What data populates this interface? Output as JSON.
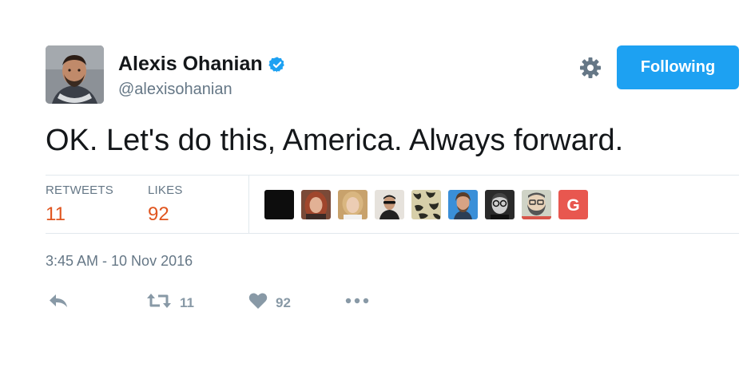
{
  "tweet": {
    "author_name": "Alexis Ohanian",
    "handle": "@alexisohanian",
    "text": "OK. Let's do this, America. Always forward.",
    "timestamp": "3:45 AM - 10 Nov 2016"
  },
  "follow_button": {
    "label": "Following",
    "color": "#1da1f2"
  },
  "stats": {
    "retweets_label": "RETWEETS",
    "retweets_value": "11",
    "likes_label": "LIKES",
    "likes_value": "92",
    "value_color": "#e0551f"
  },
  "likers": [
    {
      "icon": "avatar-black"
    },
    {
      "icon": "avatar-woman-red-hair"
    },
    {
      "icon": "avatar-woman-blonde"
    },
    {
      "icon": "avatar-man-sunglasses"
    },
    {
      "icon": "avatar-pattern"
    },
    {
      "icon": "avatar-man-blue-bg"
    },
    {
      "icon": "avatar-man-glasses-bw"
    },
    {
      "icon": "avatar-bearded-cartoon"
    },
    {
      "icon": "avatar-g-letter",
      "letter": "G",
      "color": "#e8574f"
    }
  ],
  "actions": {
    "retweet_count": "11",
    "like_count": "92"
  },
  "icons": [
    "verified-badge-icon",
    "gear-icon",
    "reply-icon",
    "retweet-icon",
    "heart-icon",
    "more-icon"
  ]
}
